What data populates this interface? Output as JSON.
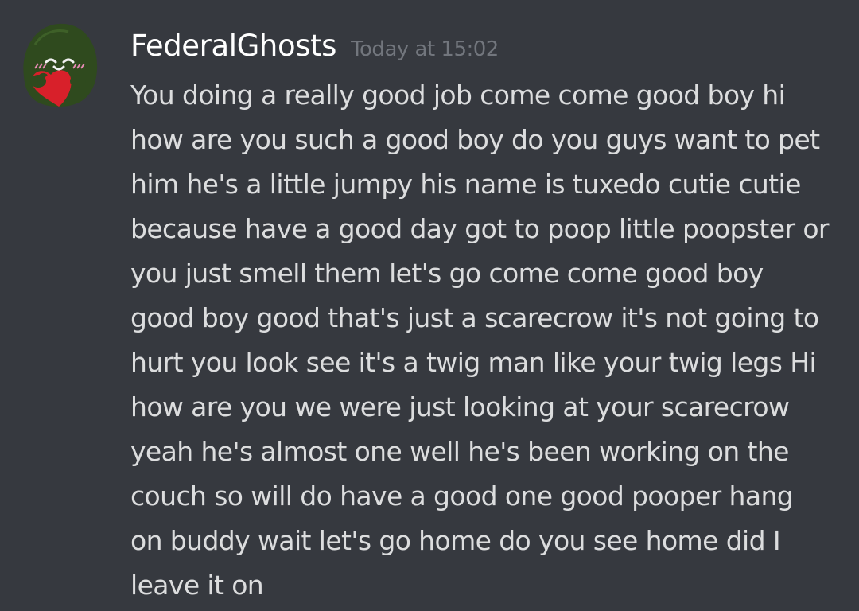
{
  "message": {
    "username": "FederalGhosts",
    "timestamp": "Today at 15:02",
    "avatar": {
      "icon": "green-blob-holding-heart-avatar",
      "colors": {
        "body": "#2f4a1e",
        "heart": "#d8202a",
        "blush": "#e58ab4"
      }
    },
    "lines": [
      "You doing a really good job come come good boy hi",
      "how are you such a good boy do you guys want to pet",
      "him he's a little jumpy his name is tuxedo cutie cutie",
      "because have a good day got to poop little poopster or",
      "you just smell them let's go come come good boy",
      "good boy good that's just a scarecrow it's not going to",
      "hurt you look see it's a twig man like your twig legs Hi",
      "how are you we were just looking at your scarecrow",
      "yeah he's almost one well he's been working on the",
      "couch so will do have a good one good pooper hang",
      "on buddy wait let's go home do you see home did I",
      "leave it on"
    ]
  },
  "theme": {
    "background": "#36393f",
    "username_color": "#ffffff",
    "timestamp_color": "#72767d",
    "text_color": "#dcddde"
  }
}
